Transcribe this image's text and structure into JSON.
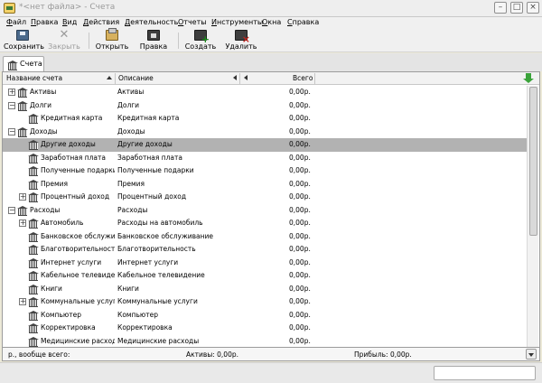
{
  "window": {
    "title": "*<нет файла> - Счета",
    "minimize_glyph": "–",
    "maximize_glyph": "□",
    "close_glyph": "×"
  },
  "menu": [
    "Файл",
    "Правка",
    "Вид",
    "Действия",
    "Деятельность",
    "Отчеты",
    "Инструменты",
    "Окна",
    "Справка"
  ],
  "toolbar": {
    "save": "Сохранить",
    "close": "Закрыть",
    "open": "Открыть",
    "edit": "Правка",
    "new": "Создать",
    "delete": "Удалить"
  },
  "tab": {
    "label": "Счета"
  },
  "table": {
    "columns": {
      "name": "Название счета",
      "description": "Описание",
      "total": "Всего"
    },
    "rows": [
      {
        "name": "Активы",
        "description": "Активы",
        "total": "0,00р.",
        "depth": 0,
        "expander": "+"
      },
      {
        "name": "Долги",
        "description": "Долги",
        "total": "0,00р.",
        "depth": 0,
        "expander": "−"
      },
      {
        "name": "Кредитная карта",
        "description": "Кредитная карта",
        "total": "0,00р.",
        "depth": 1,
        "expander": ""
      },
      {
        "name": "Доходы",
        "description": "Доходы",
        "total": "0,00р.",
        "depth": 0,
        "expander": "−"
      },
      {
        "name": "Другие доходы",
        "description": "Другие доходы",
        "total": "0,00р.",
        "depth": 1,
        "expander": "",
        "selected": true
      },
      {
        "name": "Заработная плата",
        "description": "Заработная плата",
        "total": "0,00р.",
        "depth": 1,
        "expander": ""
      },
      {
        "name": "Полученные подарки",
        "description": "Полученные подарки",
        "total": "0,00р.",
        "depth": 1,
        "expander": ""
      },
      {
        "name": "Премия",
        "description": "Премия",
        "total": "0,00р.",
        "depth": 1,
        "expander": ""
      },
      {
        "name": "Процентный доход",
        "description": "Процентный доход",
        "total": "0,00р.",
        "depth": 1,
        "expander": "+"
      },
      {
        "name": "Расходы",
        "description": "Расходы",
        "total": "0,00р.",
        "depth": 0,
        "expander": "−"
      },
      {
        "name": "Автомобиль",
        "description": "Расходы на автомобиль",
        "total": "0,00р.",
        "depth": 1,
        "expander": "+"
      },
      {
        "name": "Банковское обслуживан",
        "description": "Банковское обслуживание",
        "total": "0,00р.",
        "depth": 1,
        "expander": ""
      },
      {
        "name": "Благотворительность",
        "description": "Благотворительность",
        "total": "0,00р.",
        "depth": 1,
        "expander": ""
      },
      {
        "name": "Интернет услуги",
        "description": "Интернет услуги",
        "total": "0,00р.",
        "depth": 1,
        "expander": ""
      },
      {
        "name": "Кабельное телевидение",
        "description": "Кабельное телевидение",
        "total": "0,00р.",
        "depth": 1,
        "expander": ""
      },
      {
        "name": "Книги",
        "description": "Книги",
        "total": "0,00р.",
        "depth": 1,
        "expander": ""
      },
      {
        "name": "Коммунальные услуги",
        "description": "Коммунальные услуги",
        "total": "0,00р.",
        "depth": 1,
        "expander": "+"
      },
      {
        "name": "Компьютер",
        "description": "Компьютер",
        "total": "0,00р.",
        "depth": 1,
        "expander": ""
      },
      {
        "name": "Корректировка",
        "description": "Корректировка",
        "total": "0,00р.",
        "depth": 1,
        "expander": ""
      },
      {
        "name": "Медицинские расходы",
        "description": "Медицинские расходы",
        "total": "0,00р.",
        "depth": 1,
        "expander": ""
      }
    ]
  },
  "totals": {
    "left": "р., вообще всего:",
    "assets": "Активы: 0,00р.",
    "profit": "Прибыль: 0,00р."
  },
  "icons": {
    "account": "bank-icon",
    "filter": "green-down-arrow-icon"
  }
}
